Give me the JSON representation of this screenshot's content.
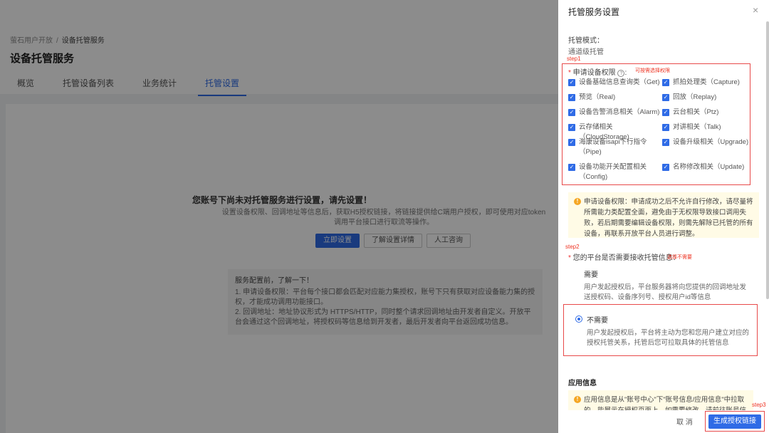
{
  "breadcrumb": [
    "萤石用户开放",
    "设备托管服务"
  ],
  "page_title": "设备托管服务",
  "tabs": [
    {
      "label": "概览"
    },
    {
      "label": "托管设备列表"
    },
    {
      "label": "业务统计"
    },
    {
      "label": "托管设置",
      "active": true
    }
  ],
  "empty_state": {
    "title": "您账号下尚未对托管服务进行设置，请先设置！",
    "desc": "设置设备权限、回调地址等信息后，获取H5授权链接，将链接提供给C端用户授权，即可使用对应token调用平台接口进行取流等操作。",
    "buttons": [
      "立即设置",
      "了解设置详情",
      "人工咨询"
    ],
    "info_title": "服务配置前，了解一下！",
    "info_lines": [
      "1. 申请设备权限：平台每个接口都会匹配对应能力集授权，账号下只有获取对应设备能力集的授权，才能成功调用功能接口。",
      "2. 回调地址：地址协议形式为 HTTPS/HTTP，同时整个请求回调地址由开发者自定义。开放平台会通过这个回调地址，将授权码等信息给到开发者，最后开发者向平台返回成功信息。"
    ]
  },
  "drawer": {
    "title": "托管服务设置",
    "close_icon": "×",
    "mode_label": "托管模式：",
    "mode_value": "通道级托管",
    "step1": "step1",
    "perm_label": "申请设备权限",
    "perm_note": "可按需选择权限",
    "permissions": [
      "设备基础信息查询类（Get)",
      "抓拍处理类（Capture)",
      "预览（Real)",
      "回放（Replay)",
      "设备告警消息相关（Alarm)",
      "云台相关（Ptz)",
      "云存储相关（CloudStorage)",
      "对讲相关（Talk)",
      "海康设备isapi下行指令（Pipe)",
      "设备升级相关（Upgrade)",
      "设备功能开关配置相关（Config)",
      "名称修改相关（Update)"
    ],
    "warn1": "申请设备权限：申请成功之后不允许自行修改，请尽量将所需能力类配置全面，避免由于无权限导致接口调用失败，若后期需要编辑设备权限，则需先解除已托管的所有设备，再联系开放平台人员进行调整。",
    "step2": "step2",
    "platform_label": "您的平台是否需要接收托管信息：",
    "platform_note": "选择不需要",
    "option_need_title": "需要",
    "option_need_desc": "用户发起授权后，平台服务器将向您提供的回调地址发送授权码、设备序列号、授权用户id等信息",
    "option_noneed_title": "不需要",
    "option_noneed_desc": "用户发起授权后，平台将主动为您和您用户建立对应的授权托管关系，托管后您可拉取具体的托管信息",
    "app_info_label": "应用信息",
    "warn2": "应用信息是从\"账号中心\"下\"账号信息/应用信息\"中拉取的，能展示在授权页面上，如需要修改，请前往账号信息中心",
    "step3": "step3",
    "cancel_label": "取 消",
    "generate_label": "生成授权链接"
  }
}
